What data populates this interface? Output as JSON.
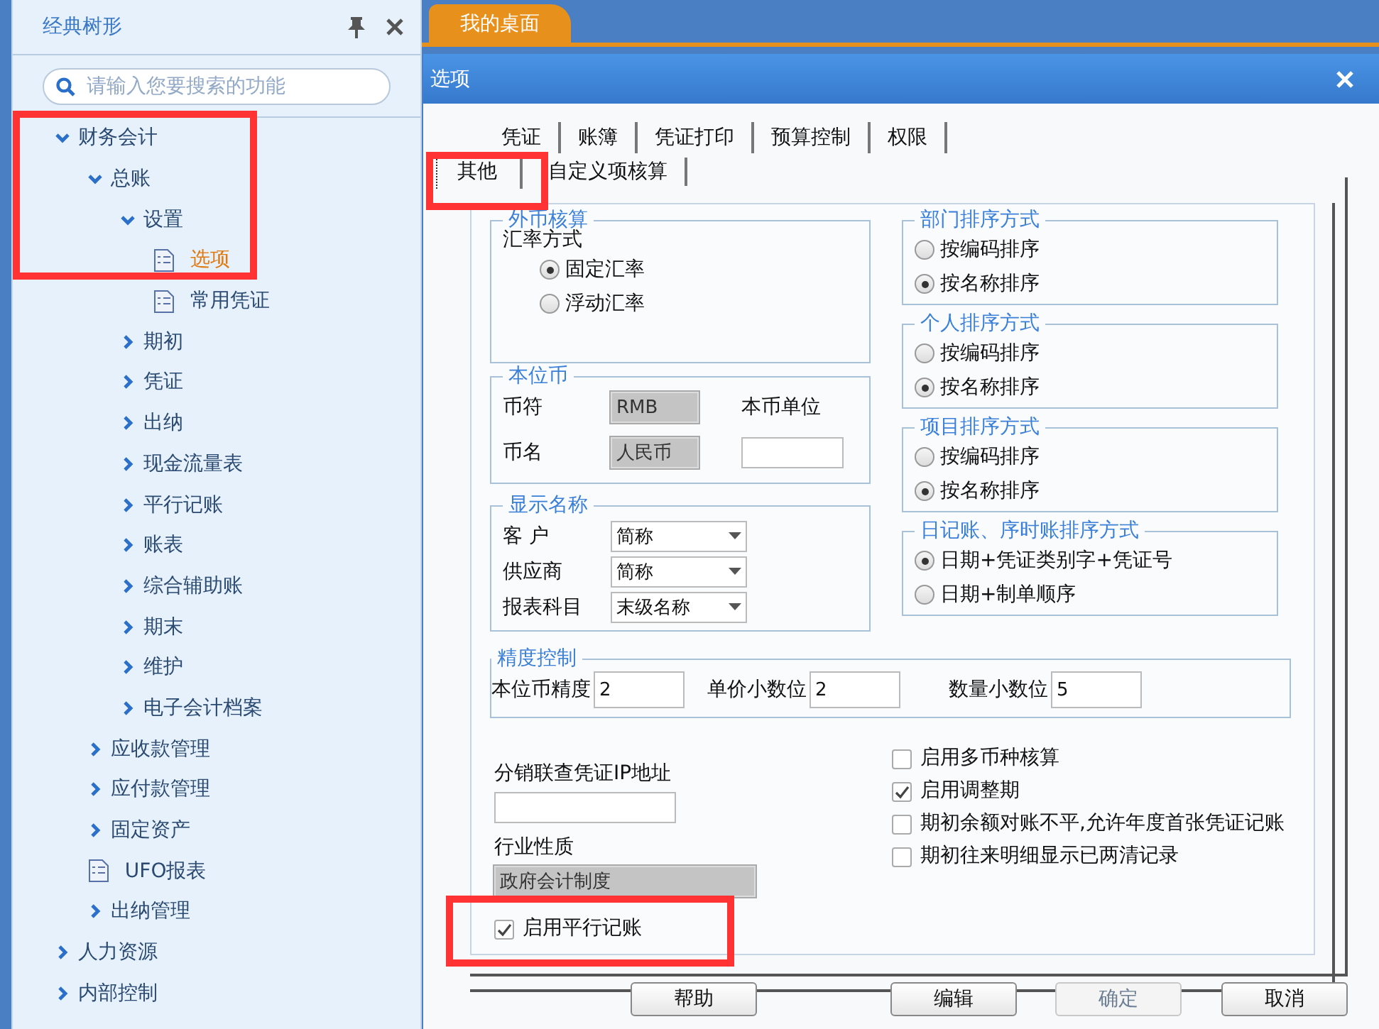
{
  "sidebar": {
    "title": "经典树形",
    "search": {
      "placeholder": "请输入您要搜索的功能"
    },
    "tree": [
      {
        "label": "财务会计",
        "kind": "folder",
        "expanded": true,
        "selected": false,
        "highlighted": true,
        "children": [
          {
            "label": "总账",
            "kind": "folder",
            "expanded": true,
            "selected": false,
            "children": [
              {
                "label": "设置",
                "kind": "folder",
                "expanded": true,
                "selected": false,
                "children": [
                  {
                    "label": "选项",
                    "kind": "doc",
                    "selected": true
                  },
                  {
                    "label": "常用凭证",
                    "kind": "doc",
                    "selected": false
                  }
                ]
              },
              {
                "label": "期初",
                "kind": "folder",
                "expanded": false,
                "selected": false
              },
              {
                "label": "凭证",
                "kind": "folder",
                "expanded": false,
                "selected": false
              },
              {
                "label": "出纳",
                "kind": "folder",
                "expanded": false,
                "selected": false
              },
              {
                "label": "现金流量表",
                "kind": "folder",
                "expanded": false,
                "selected": false
              },
              {
                "label": "平行记账",
                "kind": "folder",
                "expanded": false,
                "selected": false
              },
              {
                "label": "账表",
                "kind": "folder",
                "expanded": false,
                "selected": false
              },
              {
                "label": "综合辅助账",
                "kind": "folder",
                "expanded": false,
                "selected": false
              },
              {
                "label": "期末",
                "kind": "folder",
                "expanded": false,
                "selected": false
              },
              {
                "label": "维护",
                "kind": "folder",
                "expanded": false,
                "selected": false
              },
              {
                "label": "电子会计档案",
                "kind": "folder",
                "expanded": false,
                "selected": false
              }
            ]
          },
          {
            "label": "应收款管理",
            "kind": "folder",
            "expanded": false,
            "selected": false
          },
          {
            "label": "应付款管理",
            "kind": "folder",
            "expanded": false,
            "selected": false
          },
          {
            "label": "固定资产",
            "kind": "folder",
            "expanded": false,
            "selected": false
          },
          {
            "label": "UFO报表",
            "kind": "doc",
            "selected": false
          },
          {
            "label": "出纳管理",
            "kind": "folder",
            "expanded": false,
            "selected": false
          }
        ]
      },
      {
        "label": "人力资源",
        "kind": "folder",
        "expanded": false,
        "selected": false
      },
      {
        "label": "内部控制",
        "kind": "folder",
        "expanded": false,
        "selected": false
      }
    ]
  },
  "workspace_tabs": [
    {
      "label": "我的桌面",
      "selected": true
    }
  ],
  "dialog": {
    "title": "选项",
    "tabs_row_1": [
      {
        "label": "凭证",
        "selected": false
      },
      {
        "label": "账簿",
        "selected": false
      },
      {
        "label": "凭证打印",
        "selected": false
      },
      {
        "label": "预算控制",
        "selected": false
      },
      {
        "label": "权限",
        "selected": false
      }
    ],
    "tabs_row_2": [
      {
        "label": "其他",
        "selected": true,
        "highlighted": true
      },
      {
        "label": "自定义项核算",
        "selected": false,
        "highlighted": false
      }
    ],
    "foreign_currency": {
      "title": "外币核算",
      "label": "汇率方式",
      "options": [
        {
          "label": "固定汇率",
          "selected": true
        },
        {
          "label": "浮动汇率",
          "selected": false
        }
      ]
    },
    "base_currency": {
      "title": "本位币",
      "fields": [
        {
          "label": "币符",
          "value": "RMB",
          "disabled": true
        },
        {
          "label": "币名",
          "value": "人民币",
          "disabled": true
        }
      ],
      "unit": {
        "label": "本币单位"
      }
    },
    "display_names": {
      "title": "显示名称",
      "rows": [
        {
          "label": "客 户",
          "value": "简称"
        },
        {
          "label": "供应商",
          "value": "简称"
        },
        {
          "label": "报表科目",
          "value": "末级名称"
        }
      ]
    },
    "sort_groups": [
      {
        "title": "部门排序方式",
        "options": [
          {
            "label": "按编码排序",
            "selected": false
          },
          {
            "label": "按名称排序",
            "selected": true
          }
        ]
      },
      {
        "title": "个人排序方式",
        "options": [
          {
            "label": "按编码排序",
            "selected": false
          },
          {
            "label": "按名称排序",
            "selected": true
          }
        ]
      },
      {
        "title": "项目排序方式",
        "options": [
          {
            "label": "按编码排序",
            "selected": false
          },
          {
            "label": "按名称排序",
            "selected": true
          }
        ]
      },
      {
        "title": "日记账、序时账排序方式",
        "options": [
          {
            "label": "日期+凭证类别字+凭证号",
            "selected": true
          },
          {
            "label": "日期+制单顺序",
            "selected": false
          }
        ]
      }
    ],
    "precision": {
      "title": "精度控制",
      "fields": [
        {
          "label": "本位币精度",
          "value": "2"
        },
        {
          "label": "单价小数位",
          "value": "2"
        },
        {
          "label": "数量小数位",
          "value": "5"
        }
      ]
    },
    "ip_field": {
      "label": "分销联查凭证IP地址"
    },
    "industry": {
      "label": "行业性质",
      "value": "政府会计制度",
      "disabled": true
    },
    "left_checks": [
      {
        "label": "启用平行记账",
        "checked": true,
        "highlighted": true
      }
    ],
    "right_checks": [
      {
        "label": "启用多币种核算",
        "checked": false
      },
      {
        "label": "启用调整期",
        "checked": true
      },
      {
        "label": "期初余额对账不平,允许年度首张凭证记账",
        "checked": false
      },
      {
        "label": "期初往来明细显示已两清记录",
        "checked": false
      }
    ],
    "buttons": [
      {
        "label": "帮助",
        "disabled": false
      },
      {
        "label": "编辑",
        "disabled": false
      },
      {
        "label": "确定",
        "disabled": true
      },
      {
        "label": "取消",
        "disabled": false
      }
    ]
  }
}
